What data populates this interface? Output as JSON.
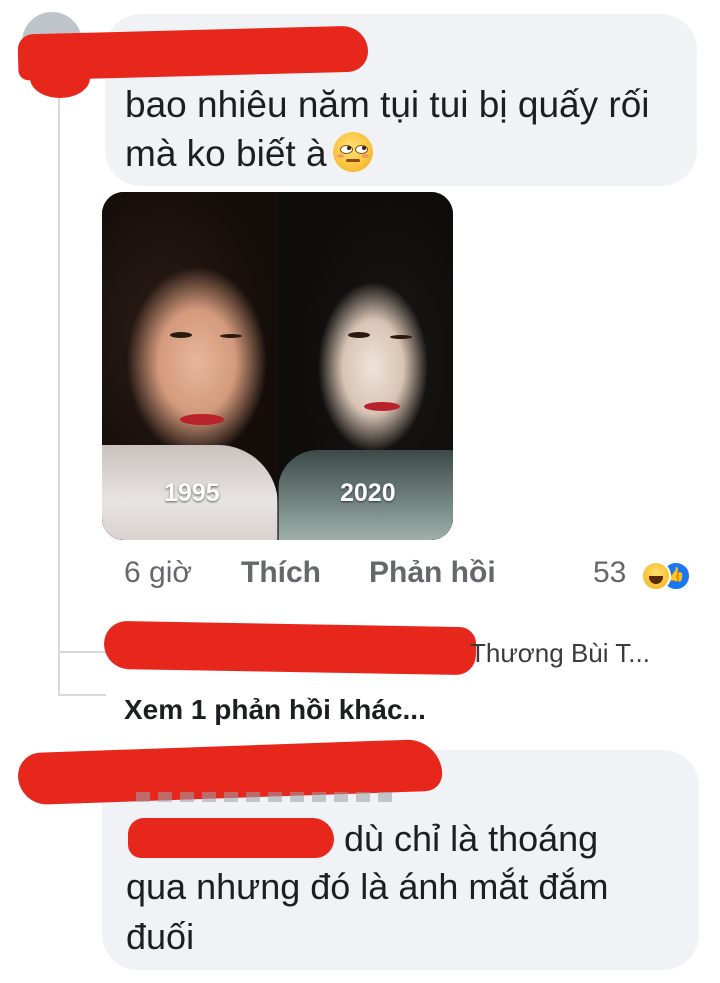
{
  "comment1": {
    "text": "bao nhiêu năm tụi tui bị quấy rối mà ko biết à",
    "emoji": "smirking-face-icon",
    "photo": {
      "left_year": "1995",
      "right_year": "2020"
    },
    "time": "6 giờ",
    "like_label": "Thích",
    "reply_label": "Phản hồi",
    "reaction_count": "53",
    "reactions": [
      "haha-icon",
      "like-icon"
    ]
  },
  "reply_preview": {
    "text": "Thương Bùi T..."
  },
  "view_more": {
    "label": "Xem 1 phản hồi khác..."
  },
  "comment2": {
    "text_line1": "dù chỉ là thoáng",
    "text_rest": "qua nhưng đó là ánh mắt đắm đuối"
  },
  "colors": {
    "bubble": "#f0f2f5",
    "redaction": "#e8271c",
    "secondary_text": "#65676b",
    "like_blue": "#1877f2"
  }
}
